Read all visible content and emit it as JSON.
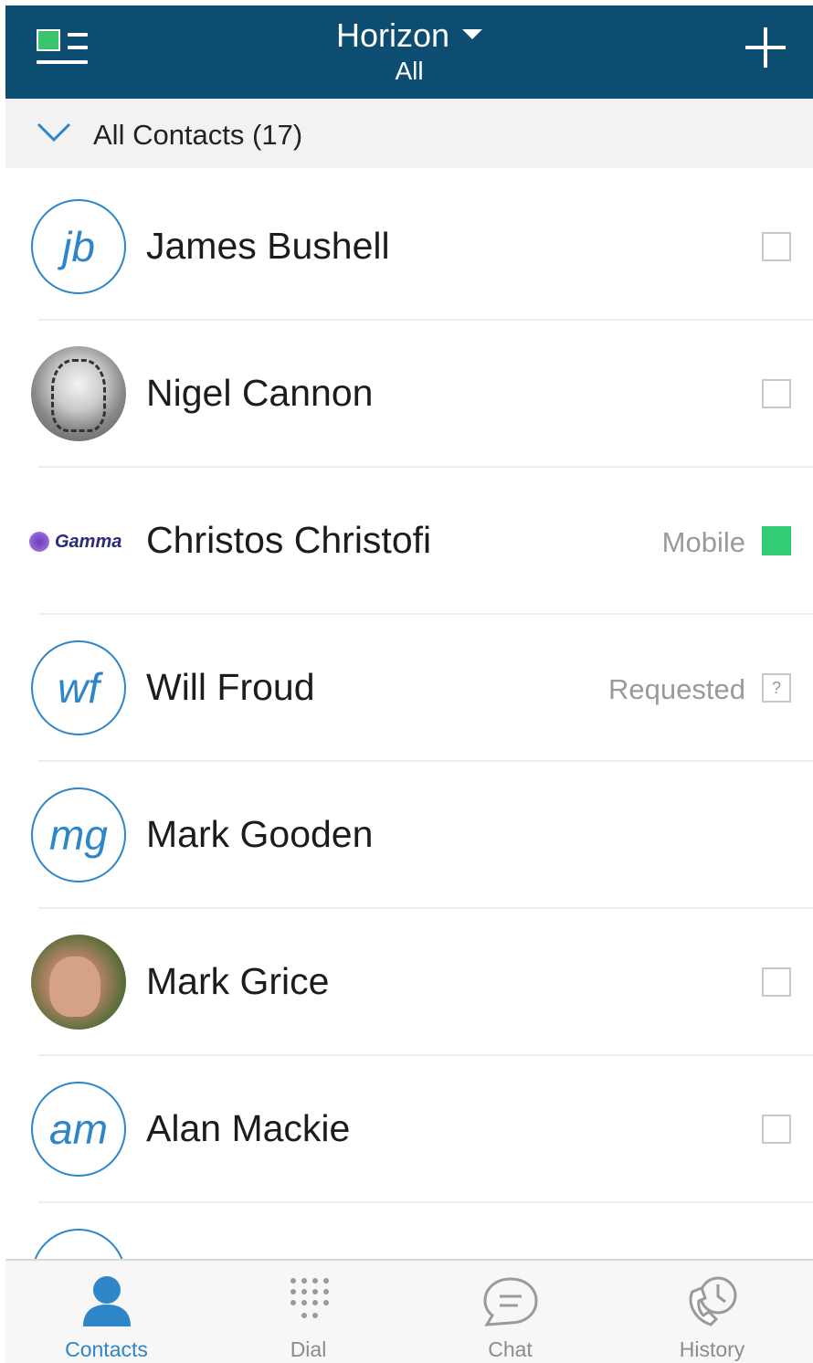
{
  "header": {
    "title": "Horizon",
    "subtitle": "All",
    "menu_icon": "menu-icon",
    "add_icon": "plus-icon"
  },
  "section": {
    "label": "All Contacts (17)",
    "icon": "chevron-down-icon"
  },
  "contacts": [
    {
      "initials": "jb",
      "name": "James Bushell",
      "status": "",
      "presence": "offline"
    },
    {
      "initials": "",
      "name": "Nigel Cannon",
      "status": "",
      "presence": "offline"
    },
    {
      "initials": "",
      "logo_text": "Gamma",
      "name": "Christos Christofi",
      "status": "Mobile",
      "presence": "available"
    },
    {
      "initials": "wf",
      "name": "Will Froud",
      "status": "Requested",
      "presence": "unknown",
      "unknown_mark": "?"
    },
    {
      "initials": "mg",
      "name": "Mark Gooden",
      "status": "",
      "presence": "none"
    },
    {
      "initials": "",
      "name": "Mark Grice",
      "status": "",
      "presence": "offline"
    },
    {
      "initials": "am",
      "name": "Alan Mackie",
      "status": "",
      "presence": "offline"
    }
  ],
  "tabs": [
    {
      "label": "Contacts",
      "icon": "person-icon",
      "active": true
    },
    {
      "label": "Dial",
      "icon": "dialpad-icon",
      "active": false
    },
    {
      "label": "Chat",
      "icon": "chat-bubble-icon",
      "active": false
    },
    {
      "label": "History",
      "icon": "phone-clock-icon",
      "active": false
    }
  ],
  "colors": {
    "header_bg": "#0e4d72",
    "accent": "#2e86c9",
    "available": "#33cc77"
  }
}
